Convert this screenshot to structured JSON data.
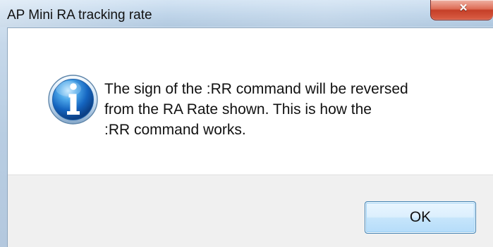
{
  "window": {
    "title": "AP Mini RA tracking rate",
    "close_icon": "close-icon",
    "colors": {
      "titlebar": "#c6d8ea",
      "close_button": "#d95e45",
      "message_background": "#ffffff",
      "button_area_background": "#f0f0f0"
    }
  },
  "message": {
    "icon": "info-icon",
    "lines": [
      "The sign of the :RR command will be reversed",
      "from the RA Rate shown.  This is how the",
      ":RR command works."
    ]
  },
  "buttons": {
    "ok_label": "OK"
  }
}
